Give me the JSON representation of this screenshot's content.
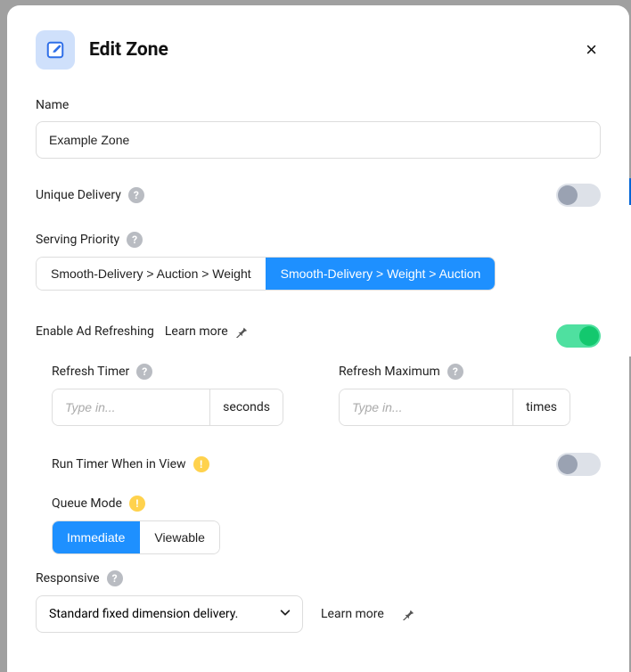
{
  "header": {
    "title": "Edit Zone",
    "icon": "edit-square-icon",
    "close": "×"
  },
  "name": {
    "label": "Name",
    "value": "Example Zone"
  },
  "uniqueDelivery": {
    "label": "Unique Delivery",
    "enabled": false
  },
  "servingPriority": {
    "label": "Serving Priority",
    "options": [
      "Smooth-Delivery > Auction > Weight",
      "Smooth-Delivery > Weight > Auction"
    ],
    "selected": 1
  },
  "adRefreshing": {
    "label": "Enable Ad Refreshing",
    "learnMore": "Learn more",
    "enabled": true,
    "refreshTimer": {
      "label": "Refresh Timer",
      "placeholder": "Type in...",
      "value": "",
      "suffix": "seconds"
    },
    "refreshMax": {
      "label": "Refresh Maximum",
      "placeholder": "Type in...",
      "value": "",
      "suffix": "times"
    },
    "runTimerInView": {
      "label": "Run Timer When in View",
      "enabled": false
    },
    "queueMode": {
      "label": "Queue Mode",
      "options": [
        "Immediate",
        "Viewable"
      ],
      "selected": 0
    }
  },
  "responsive": {
    "label": "Responsive",
    "selected": "Standard fixed dimension delivery.",
    "learnMore": "Learn more"
  },
  "glyphs": {
    "help": "?",
    "warn": "!"
  }
}
